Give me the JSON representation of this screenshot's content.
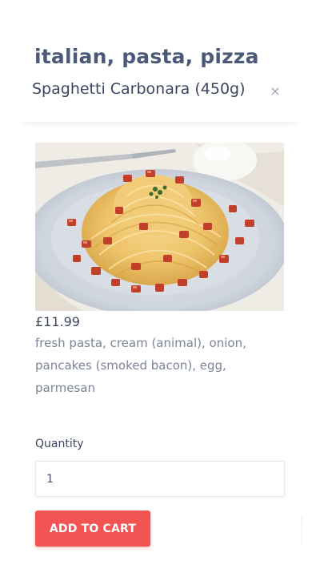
{
  "category": "italian, pasta, pizza",
  "product": {
    "title": "Spaghetti Carbonara (450g)",
    "price": "£11.99",
    "description": "fresh pasta, cream (animal), onion, pancakes (smoked bacon), egg, parmesan",
    "image_alt": "Spaghetti Carbonara"
  },
  "close_icon": "close-icon",
  "close_glyph": "×",
  "form": {
    "quantity_label": "Quantity",
    "quantity_value": "1"
  },
  "actions": {
    "add_to_cart_label": "ADD TO CART"
  },
  "colors": {
    "accent": "#f25353",
    "heading": "#4a5a78",
    "text": "#3b4660",
    "muted": "#7c8596"
  }
}
